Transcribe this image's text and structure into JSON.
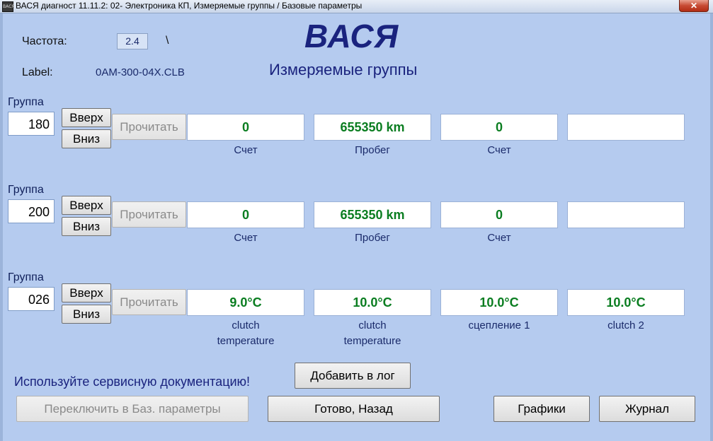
{
  "window": {
    "title": "ВАСЯ диагност 11.11.2: 02- Электроника КП,  Измеряемые группы / Базовые параметры",
    "close_label": "✕",
    "icon_text": "ВАСЯ"
  },
  "header": {
    "freq_label": "Частота:",
    "freq_value": "2.4",
    "spinner": "\\",
    "file_label": "Label:",
    "file_value": "0AM-300-04X.CLB",
    "brand": "ВАСЯ",
    "subtitle": "Измеряемые группы"
  },
  "groups": [
    {
      "label": "Группа",
      "number": "180",
      "up": "Вверх",
      "down": "Вниз",
      "read": "Прочитать",
      "values": [
        "0",
        "655350 km",
        "0",
        ""
      ],
      "captions": [
        "Счет",
        "Пробег",
        "Счет",
        ""
      ]
    },
    {
      "label": "Группа",
      "number": "200",
      "up": "Вверх",
      "down": "Вниз",
      "read": "Прочитать",
      "values": [
        "0",
        "655350 km",
        "0",
        ""
      ],
      "captions": [
        "Счет",
        "Пробег",
        "Счет",
        ""
      ]
    },
    {
      "label": "Группа",
      "number": "026",
      "up": "Вверх",
      "down": "Вниз",
      "read": "Прочитать",
      "values": [
        "9.0°C",
        "10.0°C",
        "10.0°C",
        "10.0°C"
      ],
      "captions": [
        "clutch\ntemperature",
        "clutch\ntemperature",
        "сцепление 1",
        "clutch 2"
      ]
    }
  ],
  "footer": {
    "warning": "Используйте сервисную документацию!",
    "add_log": "Добавить в лог",
    "switch_basic": "Переключить в Баз. параметры",
    "done_back": "Готово, Назад",
    "graphs": "Графики",
    "journal": "Журнал"
  }
}
